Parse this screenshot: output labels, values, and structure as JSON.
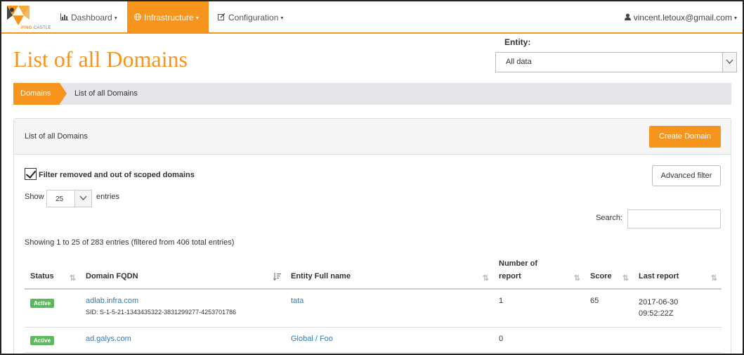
{
  "brand": {
    "logo_text_a": "PING",
    "logo_text_b": "CASTLE",
    "primary_color": "#f7941d"
  },
  "nav": {
    "items": [
      {
        "label": "Dashboard",
        "icon": "bar-chart-icon",
        "active": false
      },
      {
        "label": "Infrastructure",
        "icon": "globe-icon",
        "active": true
      },
      {
        "label": "Configuration",
        "icon": "edit-icon",
        "active": false
      }
    ],
    "user": "vincent.letoux@gmail.com"
  },
  "header": {
    "title": "List of all Domains",
    "entity_label": "Entity:",
    "entity_value": "All data"
  },
  "breadcrumb": [
    "Domains",
    "List of all Domains"
  ],
  "panel": {
    "title": "List of all Domains",
    "create_label": "Create Domain",
    "filter_label": "Filter removed and out of scoped domains",
    "filter_checked": true,
    "advanced_label": "Advanced filter",
    "show_label": "Show",
    "show_value": "25",
    "entries_label": "entries",
    "search_label": "Search:",
    "search_value": "",
    "info": "Showing 1 to 25 of 283 entries (filtered from 406 total entries)"
  },
  "table": {
    "columns": [
      "Status",
      "Domain FQDN",
      "Entity Full name",
      "Number of report",
      "Score",
      "Last report"
    ],
    "rows": [
      {
        "status": "Active",
        "fqdn": "adlab.infra.com",
        "sid": "SID: S-1-5-21-1343435322-3831299277-4253701786",
        "entity": "tata",
        "reports": "1",
        "score": "65",
        "last_report_date": "2017-06-30",
        "last_report_time": "09:52:22Z"
      },
      {
        "status": "Active",
        "fqdn": "ad.galys.com",
        "sid": "",
        "entity": "Global / Foo",
        "reports": "0",
        "score": "",
        "last_report_date": "",
        "last_report_time": ""
      }
    ]
  }
}
